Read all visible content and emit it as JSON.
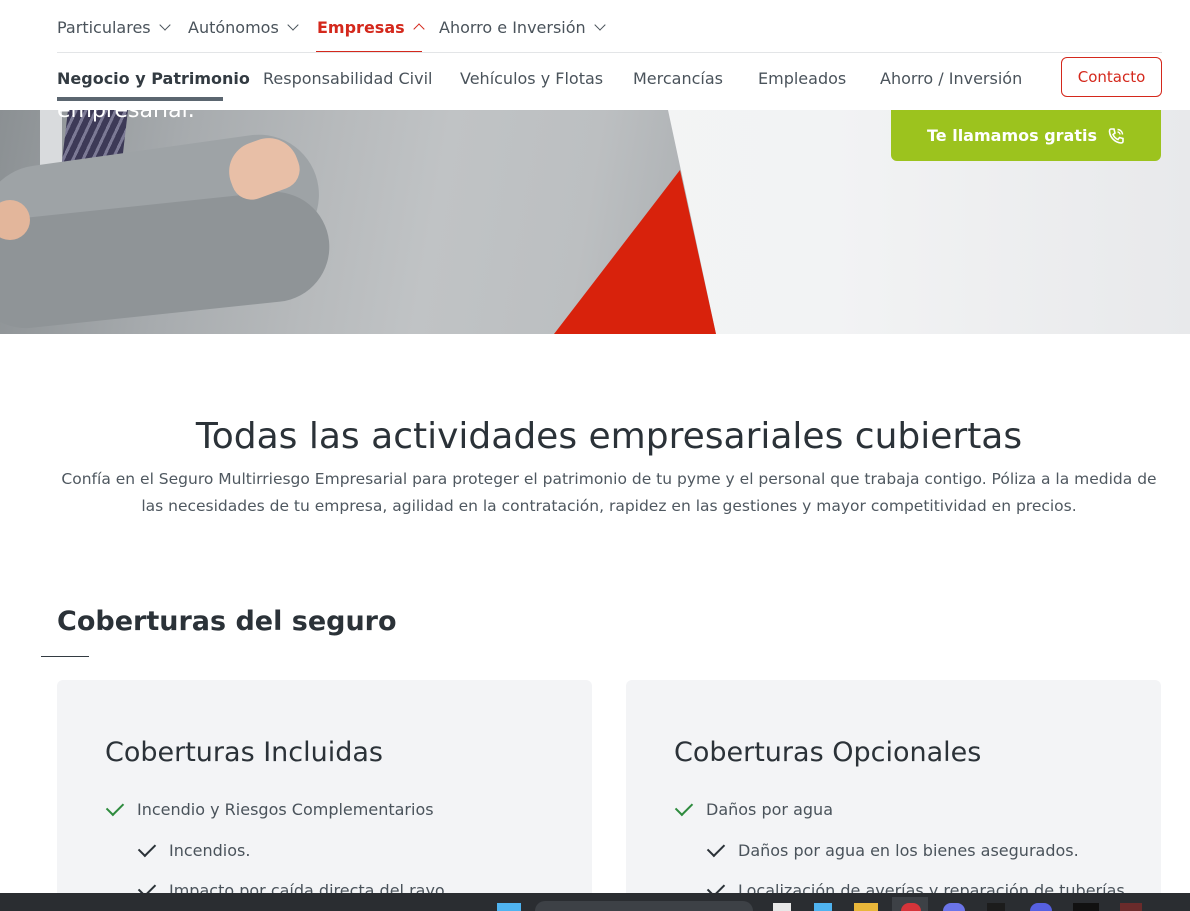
{
  "top_nav": {
    "items": [
      {
        "label": "Particulares"
      },
      {
        "label": "Autónomos"
      },
      {
        "label": "Empresas"
      },
      {
        "label": "Ahorro e Inversión"
      }
    ]
  },
  "sub_nav": {
    "items": [
      {
        "label": "Negocio y Patrimonio"
      },
      {
        "label": "Responsabilidad Civil"
      },
      {
        "label": "Vehículos y Flotas"
      },
      {
        "label": "Mercancías"
      },
      {
        "label": "Empleados"
      },
      {
        "label": "Ahorro / Inversión"
      }
    ],
    "contact_label": "Contacto"
  },
  "hero": {
    "partial_text": "empresarial.",
    "call_label": "Te llamamos gratis"
  },
  "intro": {
    "title": "Todas las actividades empresariales cubiertas",
    "text": "Confía en el Seguro Multirriesgo Empresarial para proteger el patrimonio de tu pyme y el personal que trabaja contigo. Póliza a la medida de las necesidades de tu empresa, agilidad en la contratación, rapidez en las gestiones y mayor competitividad en precios."
  },
  "coverage": {
    "title": "Coberturas del seguro",
    "included": {
      "title": "Coberturas Incluidas",
      "items": [
        "Incendio y Riesgos Complementarios",
        "Incendios.",
        "Impacto por caída directa del rayo."
      ]
    },
    "optional": {
      "title": "Coberturas Opcionales",
      "items": [
        "Daños por agua",
        "Daños por agua en los bienes asegurados.",
        "Localización de averías y reparación de tuberías."
      ]
    }
  },
  "colors": {
    "accent_red": "#d4281c",
    "call_green": "#9cc31e",
    "check_green": "#2e8b3e"
  }
}
